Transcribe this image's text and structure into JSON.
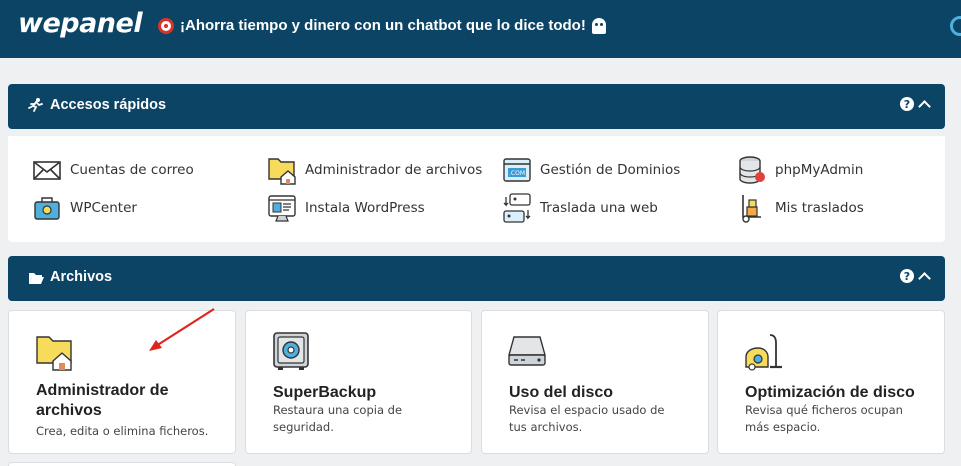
{
  "header": {
    "logo": "wepanel",
    "promo_text": "¡Ahorra tiempo y dinero con un chatbot que lo dice todo!",
    "colors": {
      "bar": "#0c4466",
      "accent": "#4fb0e0"
    }
  },
  "quick_access": {
    "title": "Accesos rápidos",
    "items": [
      {
        "label": "Cuentas de correo",
        "icon": "envelope-icon"
      },
      {
        "label": "Administrador de archivos",
        "icon": "folder-home-icon"
      },
      {
        "label": "Gestión de Dominios",
        "icon": "domain-com-icon"
      },
      {
        "label": "phpMyAdmin",
        "icon": "database-icon"
      },
      {
        "label": "WPCenter",
        "icon": "toolbox-icon"
      },
      {
        "label": "Instala WordPress",
        "icon": "installer-icon"
      },
      {
        "label": "Traslada una web",
        "icon": "transfer-icon"
      },
      {
        "label": "Mis traslados",
        "icon": "hand-truck-icon"
      }
    ]
  },
  "files_section": {
    "title": "Archivos",
    "cards": [
      {
        "title": "Administrador de archivos",
        "desc": "Crea, edita o elimina ficheros.",
        "icon": "folder-home-icon"
      },
      {
        "title": "SuperBackup",
        "desc": "Restaura una copia de seguridad.",
        "icon": "safe-icon"
      },
      {
        "title": "Uso del disco",
        "desc": "Revisa el espacio usado de tus archivos.",
        "icon": "hard-disk-icon"
      },
      {
        "title": "Optimización de disco",
        "desc": "Revisa qué ficheros ocupan más espacio.",
        "icon": "vacuum-icon"
      }
    ]
  }
}
